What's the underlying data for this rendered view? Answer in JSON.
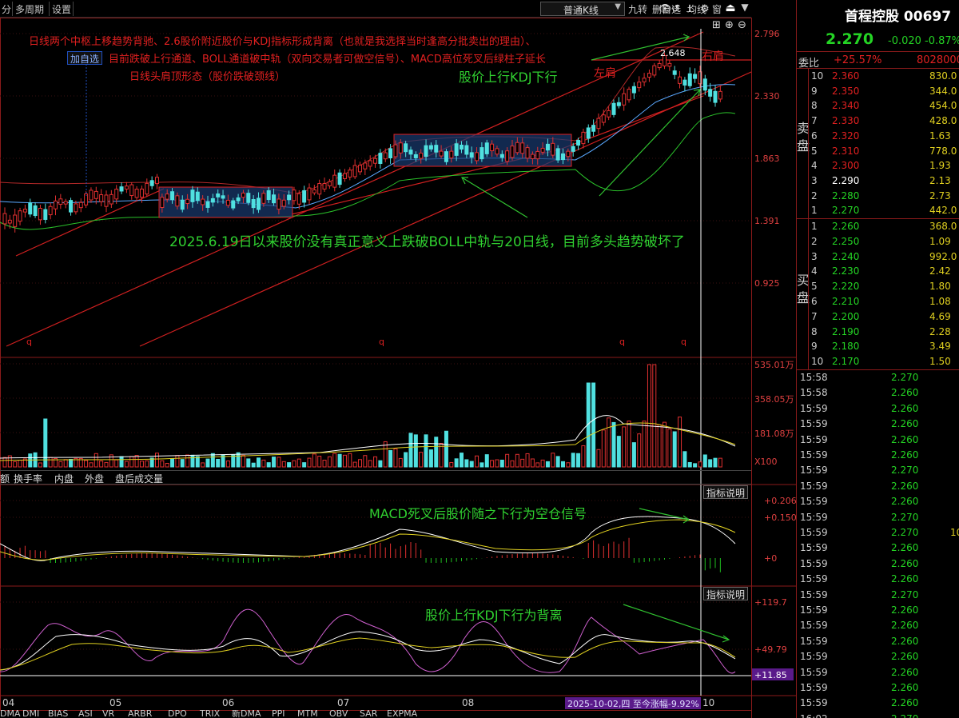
{
  "toolbar": {
    "items": [
      "分",
      "多周期",
      "设置"
    ],
    "period": "普通K线",
    "right_items": [
      "九转",
      "删自选",
      "均线",
      "窗"
    ]
  },
  "chart": {
    "add_watch": "加自选",
    "annotations": {
      "line1": "日线两个中枢上移趋势背驰、2.6股价附近股价与KDJ指标形成背离（也就是我选择当时逢高分批卖出的理由）、",
      "line2": "目前跌破上行通道、BOLL通道破中轨（双向交易者可做空信号）、MACD高位死叉后绿柱子延长",
      "line3": "日线头肩顶形态（股价跌破颈线）",
      "kdj_up": "股价上行KDJ下行",
      "left_shoulder": "左肩",
      "right_shoulder": "右肩",
      "peak": "2.648",
      "boll_note": "2025.6.19日以来股价没有真正意义上跌破BOLL中轨与20日线，目前多头趋势破坏了",
      "q": "q"
    },
    "price_axis": [
      "2.796",
      "2.330",
      "1.863",
      "1.391",
      "0.925"
    ],
    "vol_axis": [
      "535.01万",
      "358.05万",
      "181.08万",
      "X100"
    ],
    "macd_axis": [
      "+0.206",
      "+0.150",
      "+0"
    ],
    "kdj_axis": [
      "+119.7",
      "+49.79",
      "+11.85"
    ],
    "macd_note": "MACD死叉后股价随之下行为空仓信号",
    "kdj_note": "股价上行KDJ下行为背离",
    "indicator_btn": "指标说明",
    "months": [
      "04",
      "05",
      "06",
      "07",
      "08",
      "10"
    ],
    "range_label": "2025-10-02,四 至今涨幅-9.92%",
    "sub_tabs": [
      "额",
      "换手率",
      "内盘",
      "外盘",
      "盘后成交量"
    ],
    "bottom_tabs": [
      "DMA",
      "DMI",
      "BIAS",
      "ASI",
      "VR",
      "ARBR",
      "DPO",
      "TRIX",
      "新DMA",
      "PPI",
      "MTM",
      "OBV",
      "SAR",
      "EXPMA"
    ]
  },
  "quote": {
    "name": "首程控股 00697",
    "price": "2.270",
    "change": "-0.020",
    "pct": "-0.87%",
    "wb_label": "委比",
    "wb_value": "+25.57%",
    "wb_vol": "8028000",
    "sell_label": "卖盘",
    "buy_label": "买盘",
    "asks": [
      {
        "n": "10",
        "p": "2.360",
        "v": "830.0"
      },
      {
        "n": "9",
        "p": "2.350",
        "v": "344.0"
      },
      {
        "n": "8",
        "p": "2.340",
        "v": "454.0"
      },
      {
        "n": "7",
        "p": "2.330",
        "v": "428.0"
      },
      {
        "n": "6",
        "p": "2.320",
        "v": "1.63"
      },
      {
        "n": "5",
        "p": "2.310",
        "v": "778.0"
      },
      {
        "n": "4",
        "p": "2.300",
        "v": "1.93"
      },
      {
        "n": "3",
        "p": "2.290",
        "v": "2.13"
      },
      {
        "n": "2",
        "p": "2.280",
        "v": "2.73"
      },
      {
        "n": "1",
        "p": "2.270",
        "v": "442.0"
      }
    ],
    "bids": [
      {
        "n": "1",
        "p": "2.260",
        "v": "368.0"
      },
      {
        "n": "2",
        "p": "2.250",
        "v": "1.09"
      },
      {
        "n": "3",
        "p": "2.240",
        "v": "992.0"
      },
      {
        "n": "4",
        "p": "2.230",
        "v": "2.42"
      },
      {
        "n": "5",
        "p": "2.220",
        "v": "1.80"
      },
      {
        "n": "6",
        "p": "2.210",
        "v": "1.08"
      },
      {
        "n": "7",
        "p": "2.200",
        "v": "4.69"
      },
      {
        "n": "8",
        "p": "2.190",
        "v": "2.28"
      },
      {
        "n": "9",
        "p": "2.180",
        "v": "3.49"
      },
      {
        "n": "10",
        "p": "2.170",
        "v": "1.50"
      }
    ],
    "ticks": [
      {
        "t": "15:58",
        "p": "2.270",
        "v": ""
      },
      {
        "t": "15:58",
        "p": "2.260",
        "v": ""
      },
      {
        "t": "15:59",
        "p": "2.260",
        "v": ""
      },
      {
        "t": "15:59",
        "p": "2.260",
        "v": ""
      },
      {
        "t": "15:59",
        "p": "2.260",
        "v": ""
      },
      {
        "t": "15:59",
        "p": "2.260",
        "v": ""
      },
      {
        "t": "15:59",
        "p": "2.270",
        "v": ""
      },
      {
        "t": "15:59",
        "p": "2.260",
        "v": ""
      },
      {
        "t": "15:59",
        "p": "2.260",
        "v": ""
      },
      {
        "t": "15:59",
        "p": "2.270",
        "v": ""
      },
      {
        "t": "15:59",
        "p": "2.270",
        "v": "10"
      },
      {
        "t": "15:59",
        "p": "2.260",
        "v": ""
      },
      {
        "t": "15:59",
        "p": "2.260",
        "v": ""
      },
      {
        "t": "15:59",
        "p": "2.260",
        "v": ""
      },
      {
        "t": "15:59",
        "p": "2.270",
        "v": ""
      },
      {
        "t": "15:59",
        "p": "2.260",
        "v": ""
      },
      {
        "t": "15:59",
        "p": "2.260",
        "v": ""
      },
      {
        "t": "15:59",
        "p": "2.260",
        "v": ""
      },
      {
        "t": "15:59",
        "p": "2.260",
        "v": ""
      },
      {
        "t": "15:59",
        "p": "2.260",
        "v": ""
      },
      {
        "t": "15:59",
        "p": "2.260",
        "v": ""
      },
      {
        "t": "15:59",
        "p": "2.260",
        "v": ""
      },
      {
        "t": "16:02",
        "p": "2.270",
        "v": ""
      }
    ]
  }
}
